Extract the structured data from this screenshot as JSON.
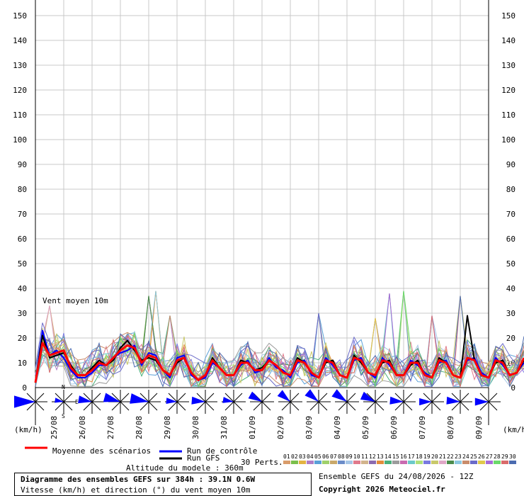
{
  "chart_data": {
    "type": "line",
    "title": "Diagramme des ensembles GEFS sur 384h : 39.1N 0.6W",
    "subtitle": "Vitesse (km/h) et direction (°) du vent moyen 10m",
    "inner_label": "Vent moyen 10m",
    "ylabel_left": "(km/h)",
    "ylabel_right": "(km/h)",
    "ylim": [
      0,
      150
    ],
    "yticks": [
      0,
      10,
      20,
      30,
      40,
      50,
      60,
      70,
      80,
      90,
      100,
      110,
      120,
      130,
      140,
      150
    ],
    "grid": true,
    "dates": [
      "25/08",
      "26/08",
      "27/08",
      "28/08",
      "29/08",
      "30/08",
      "31/08",
      "01/09",
      "02/09",
      "03/09",
      "04/09",
      "05/09",
      "06/09",
      "07/09",
      "08/09",
      "09/09"
    ],
    "x_hours": [
      0,
      384
    ],
    "step_hours": 6,
    "mean_series": [
      2,
      18,
      13,
      14,
      15,
      8,
      5,
      5,
      7,
      10,
      9,
      12,
      15,
      17,
      16,
      10,
      13,
      12,
      7,
      5,
      11,
      12,
      6,
      3,
      5,
      11,
      8,
      5,
      5,
      10,
      10,
      7,
      7,
      11,
      9,
      6,
      5,
      11,
      10,
      6,
      4,
      11,
      10,
      5,
      4,
      12,
      11,
      6,
      5,
      11,
      10,
      5,
      5,
      10,
      10,
      5,
      4,
      11,
      10,
      5,
      4,
      12,
      11,
      5,
      4,
      11,
      10,
      5,
      6,
      12
    ],
    "control_series": [
      2,
      23,
      13,
      15,
      12,
      7,
      4,
      4,
      6,
      9,
      9,
      12,
      14,
      15,
      17,
      9,
      14,
      13,
      7,
      4,
      12,
      13,
      5,
      3,
      4,
      10,
      8,
      5,
      5,
      9,
      11,
      6,
      7,
      12,
      8,
      7,
      4,
      10,
      11,
      5,
      4,
      12,
      9,
      5,
      4,
      11,
      12,
      6,
      4,
      12,
      9,
      5,
      5,
      11,
      9,
      6,
      4,
      10,
      11,
      5,
      4,
      11,
      12,
      6,
      4,
      12,
      9,
      5,
      6,
      10
    ],
    "gfs_series": [
      2,
      21,
      12,
      13,
      14,
      9,
      5,
      5,
      8,
      11,
      9,
      11,
      16,
      19,
      15,
      11,
      12,
      11,
      7,
      5,
      10,
      12,
      6,
      3,
      5,
      12,
      8,
      5,
      5,
      11,
      10,
      7,
      8,
      11,
      9,
      6,
      5,
      12,
      10,
      6,
      4,
      10,
      11,
      5,
      4,
      13,
      10,
      6,
      5,
      10,
      11,
      5,
      5,
      9,
      11,
      5,
      4,
      12,
      10,
      5,
      4,
      29,
      11,
      5,
      4,
      10,
      11,
      5,
      6,
      11
    ],
    "spread_peaks": [
      {
        "hour": 12,
        "value": 33
      },
      {
        "hour": 96,
        "value": 37
      },
      {
        "hour": 102,
        "value": 39
      },
      {
        "hour": 114,
        "value": 29
      },
      {
        "hour": 240,
        "value": 30
      },
      {
        "hour": 288,
        "value": 28
      },
      {
        "hour": 300,
        "value": 38
      },
      {
        "hour": 312,
        "value": 39
      },
      {
        "hour": 336,
        "value": 29
      },
      {
        "hour": 360,
        "value": 37
      }
    ],
    "wind_dirs": [
      {
        "hour": 0,
        "dir": 90,
        "speed": 18
      },
      {
        "hour": 24,
        "dir": 100,
        "speed": 5
      },
      {
        "hour": 48,
        "dir": 100,
        "speed": 10
      },
      {
        "hour": 72,
        "dir": 105,
        "speed": 13
      },
      {
        "hour": 96,
        "dir": 100,
        "speed": 15
      },
      {
        "hour": 120,
        "dir": 95,
        "speed": 7
      },
      {
        "hour": 144,
        "dir": 95,
        "speed": 10
      },
      {
        "hour": 168,
        "dir": 100,
        "speed": 7
      },
      {
        "hour": 192,
        "dir": 120,
        "speed": 10
      },
      {
        "hour": 216,
        "dir": 130,
        "speed": 10
      },
      {
        "hour": 240,
        "dir": 130,
        "speed": 11
      },
      {
        "hour": 264,
        "dir": 125,
        "speed": 12
      },
      {
        "hour": 288,
        "dir": 115,
        "speed": 11
      },
      {
        "hour": 312,
        "dir": 95,
        "speed": 10
      },
      {
        "hour": 336,
        "dir": 90,
        "speed": 9
      },
      {
        "hour": 360,
        "dir": 95,
        "speed": 10
      },
      {
        "hour": 384,
        "dir": 90,
        "speed": 10
      }
    ],
    "compass": {
      "n": "N",
      "s": "S",
      "e": "E"
    }
  },
  "legend": {
    "mean": "Moyenne des scénarios",
    "control": "Run de contrôle",
    "gfs": "Run GFS",
    "perts": "30 Perts.",
    "altitude": "Altitude du modele : 360m",
    "colors": {
      "mean": "#ff0000",
      "control": "#0000ff",
      "gfs": "#000000"
    }
  },
  "pert_colors": [
    "#d99c6b",
    "#7bbf4b",
    "#e3b341",
    "#b07cc6",
    "#5aa0d8",
    "#9fd06b",
    "#c9a86a",
    "#6b8cc9",
    "#a7c7e7",
    "#e07a8c",
    "#d2b48c",
    "#8c6bb0",
    "#e38c3b",
    "#4bb07c",
    "#9c9c9c",
    "#c96bb0",
    "#6bc9c9",
    "#b0e07a",
    "#7a7ae0",
    "#c9c96b",
    "#e0a7c7",
    "#4b8c4b",
    "#8cc9e0",
    "#c98c6b",
    "#6b6bc9",
    "#e0c94b",
    "#a76bd9",
    "#6bd96b",
    "#d96b6b",
    "#4b6bb0"
  ],
  "pert_nums": [
    "01",
    "02",
    "03",
    "04",
    "05",
    "06",
    "07",
    "08",
    "09",
    "10",
    "11",
    "12",
    "13",
    "14",
    "15",
    "16",
    "17",
    "18",
    "19",
    "20",
    "21",
    "22",
    "23",
    "24",
    "25",
    "26",
    "27",
    "28",
    "29",
    "30"
  ],
  "footer": {
    "ensemble": "Ensemble GEFS du 24/08/2026 - 12Z",
    "copyright": "Copyright 2026 Meteociel.fr"
  }
}
